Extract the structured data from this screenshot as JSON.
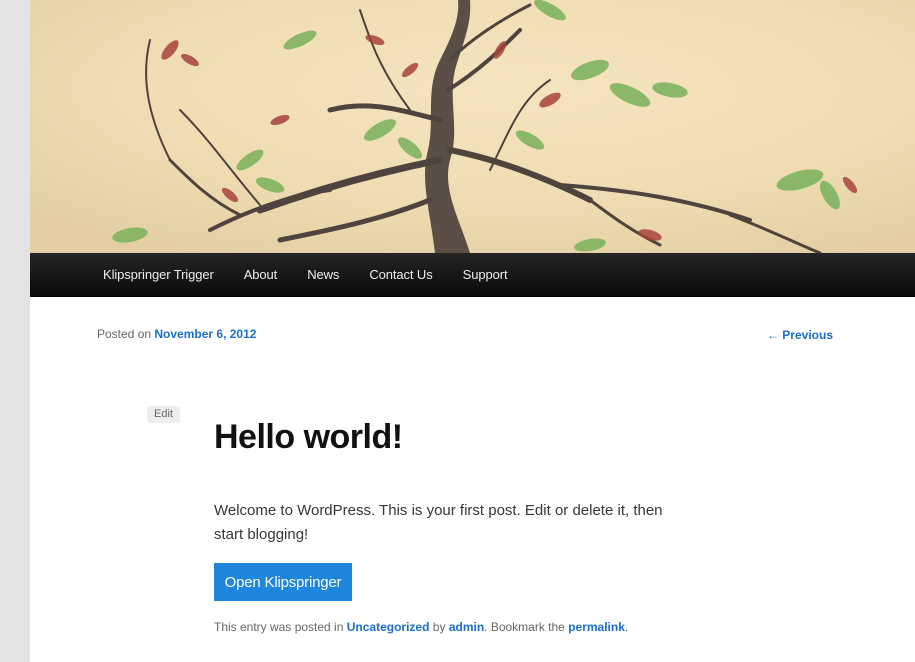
{
  "nav": {
    "items": [
      {
        "label": "Klipspringer Trigger"
      },
      {
        "label": "About"
      },
      {
        "label": "News"
      },
      {
        "label": "Contact Us"
      },
      {
        "label": "Support"
      }
    ]
  },
  "post": {
    "posted_on_prefix": "Posted on",
    "date": "November 6, 2012",
    "previous_label": "← Previous",
    "edit_label": "Edit",
    "title": "Hello world!",
    "content": "Welcome to WordPress. This is your first post. Edit or delete it, then start blogging!",
    "button_label": "Open Klipspringer",
    "meta": {
      "prefix": "This entry was posted in",
      "category": "Uncategorized",
      "by": "by",
      "author": "admin",
      "bookmark": ". Bookmark the",
      "permalink": "permalink",
      "end": "."
    }
  },
  "colors": {
    "link": "#1b6fc7",
    "button": "#1e87dd",
    "nav_bg": "#111111"
  }
}
